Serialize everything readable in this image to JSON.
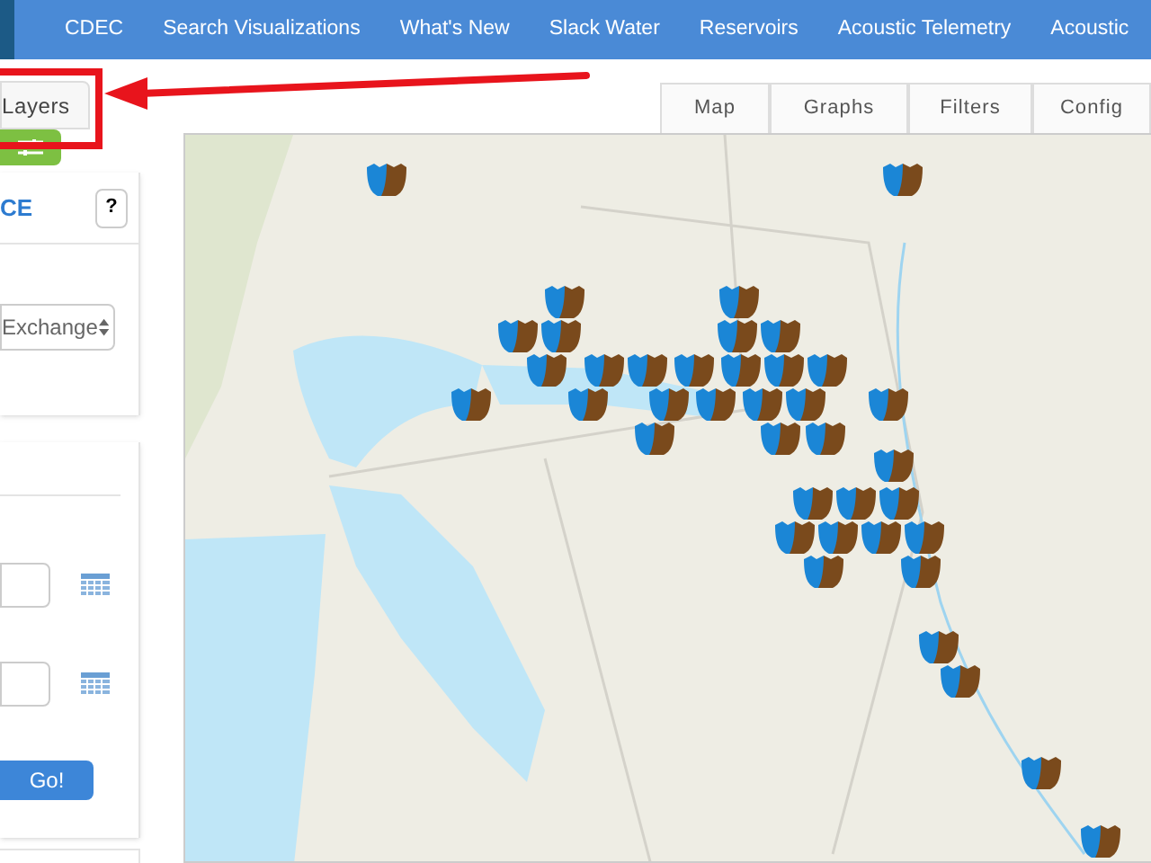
{
  "nav": {
    "items": [
      "CDEC",
      "Search Visualizations",
      "What's New",
      "Slack Water",
      "Reservoirs",
      "Acoustic Telemetry",
      "Acoustic"
    ]
  },
  "layers_tab": {
    "label": "Layers"
  },
  "station_panel": {
    "title": "CE",
    "help": "?",
    "select_value": "Exchange"
  },
  "date_panel": {
    "button": "Go!"
  },
  "view_tabs": [
    {
      "label": "Map"
    },
    {
      "label": "Graphs"
    },
    {
      "label": "Filters"
    },
    {
      "label": "Config"
    }
  ]
}
